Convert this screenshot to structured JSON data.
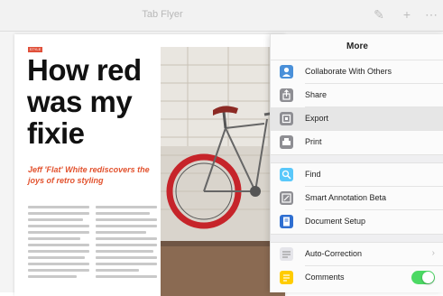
{
  "window": {
    "title": "Tab Flyer"
  },
  "article": {
    "tag": "STYLE",
    "headline": "How red was my fixie",
    "subhead": "Jeff 'Flat' White rediscovers the joys of retro styling"
  },
  "menu": {
    "title": "More",
    "items": [
      {
        "label": "Collaborate With Others",
        "icon": "people-icon",
        "color": "#4a90d9"
      },
      {
        "label": "Share",
        "icon": "share-icon",
        "color": "#8e8e93"
      },
      {
        "label": "Export",
        "icon": "export-icon",
        "color": "#8e8e93",
        "selected": true
      },
      {
        "label": "Print",
        "icon": "print-icon",
        "color": "#8e8e93"
      },
      {
        "label": "Find",
        "icon": "find-icon",
        "color": "#5ac8fa"
      },
      {
        "label": "Smart Annotation Beta",
        "icon": "annotation-icon",
        "color": "#8e8e93"
      },
      {
        "label": "Document Setup",
        "icon": "document-setup-icon",
        "color": "#2f6fd1"
      },
      {
        "label": "Auto-Correction",
        "icon": "auto-correction-icon",
        "color": "#c7c7cc"
      },
      {
        "label": "Comments",
        "icon": "comments-icon",
        "color": "#ffcc00",
        "toggle": true
      }
    ]
  },
  "colors": {
    "accent": "#e2522e",
    "toggle_on": "#4cd964"
  }
}
